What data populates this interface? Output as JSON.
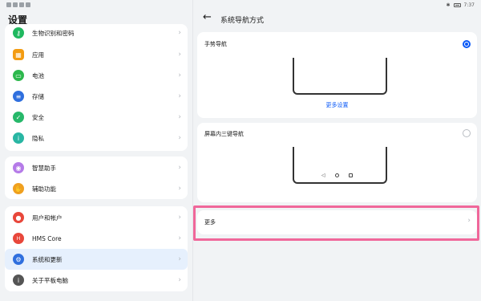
{
  "statusbar": {
    "time": "7:37"
  },
  "left": {
    "title": "设置",
    "group1": [
      {
        "label": "生物识别和密码",
        "icon": "key-icon",
        "color": "#1fb85f",
        "glyph": "⚷"
      },
      {
        "label": "应用",
        "icon": "apps-icon",
        "color": "#f39c12",
        "glyph": "▦"
      },
      {
        "label": "电池",
        "icon": "battery-icon",
        "color": "#2db84d",
        "glyph": "▭"
      },
      {
        "label": "存储",
        "icon": "storage-icon",
        "color": "#2f6fde",
        "glyph": "≡"
      },
      {
        "label": "安全",
        "icon": "shield-icon",
        "color": "#27b86a",
        "glyph": "✓"
      },
      {
        "label": "隐私",
        "icon": "privacy-icon",
        "color": "#29b6a3",
        "glyph": "i"
      }
    ],
    "group2": [
      {
        "label": "智慧助手",
        "icon": "assistant-icon",
        "color": "#b57be8",
        "glyph": "◉"
      },
      {
        "label": "辅助功能",
        "icon": "accessibility-icon",
        "color": "#f0a020",
        "glyph": "✋"
      }
    ],
    "group3": [
      {
        "label": "用户和帐户",
        "icon": "user-icon",
        "color": "#e8473b",
        "glyph": "●"
      },
      {
        "label": "HMS Core",
        "icon": "hms-core-icon",
        "color": "#e8473b",
        "glyph": "H"
      },
      {
        "label": "系统和更新",
        "icon": "system-gear-icon",
        "color": "#2f6fde",
        "glyph": "⚙"
      },
      {
        "label": "关于平板电脑",
        "icon": "about-info-icon",
        "color": "#555555",
        "glyph": "i"
      }
    ],
    "chevron": "›"
  },
  "right": {
    "back_glyph": "←",
    "title": "系统导航方式",
    "gesture": {
      "title": "手势导航",
      "more_settings": "更多设置",
      "selected": true
    },
    "three_key": {
      "title": "屏幕内三键导航",
      "selected": false,
      "buttons": [
        "◁",
        "○",
        "□"
      ]
    },
    "more": {
      "label": "更多"
    },
    "chevron": "›"
  }
}
